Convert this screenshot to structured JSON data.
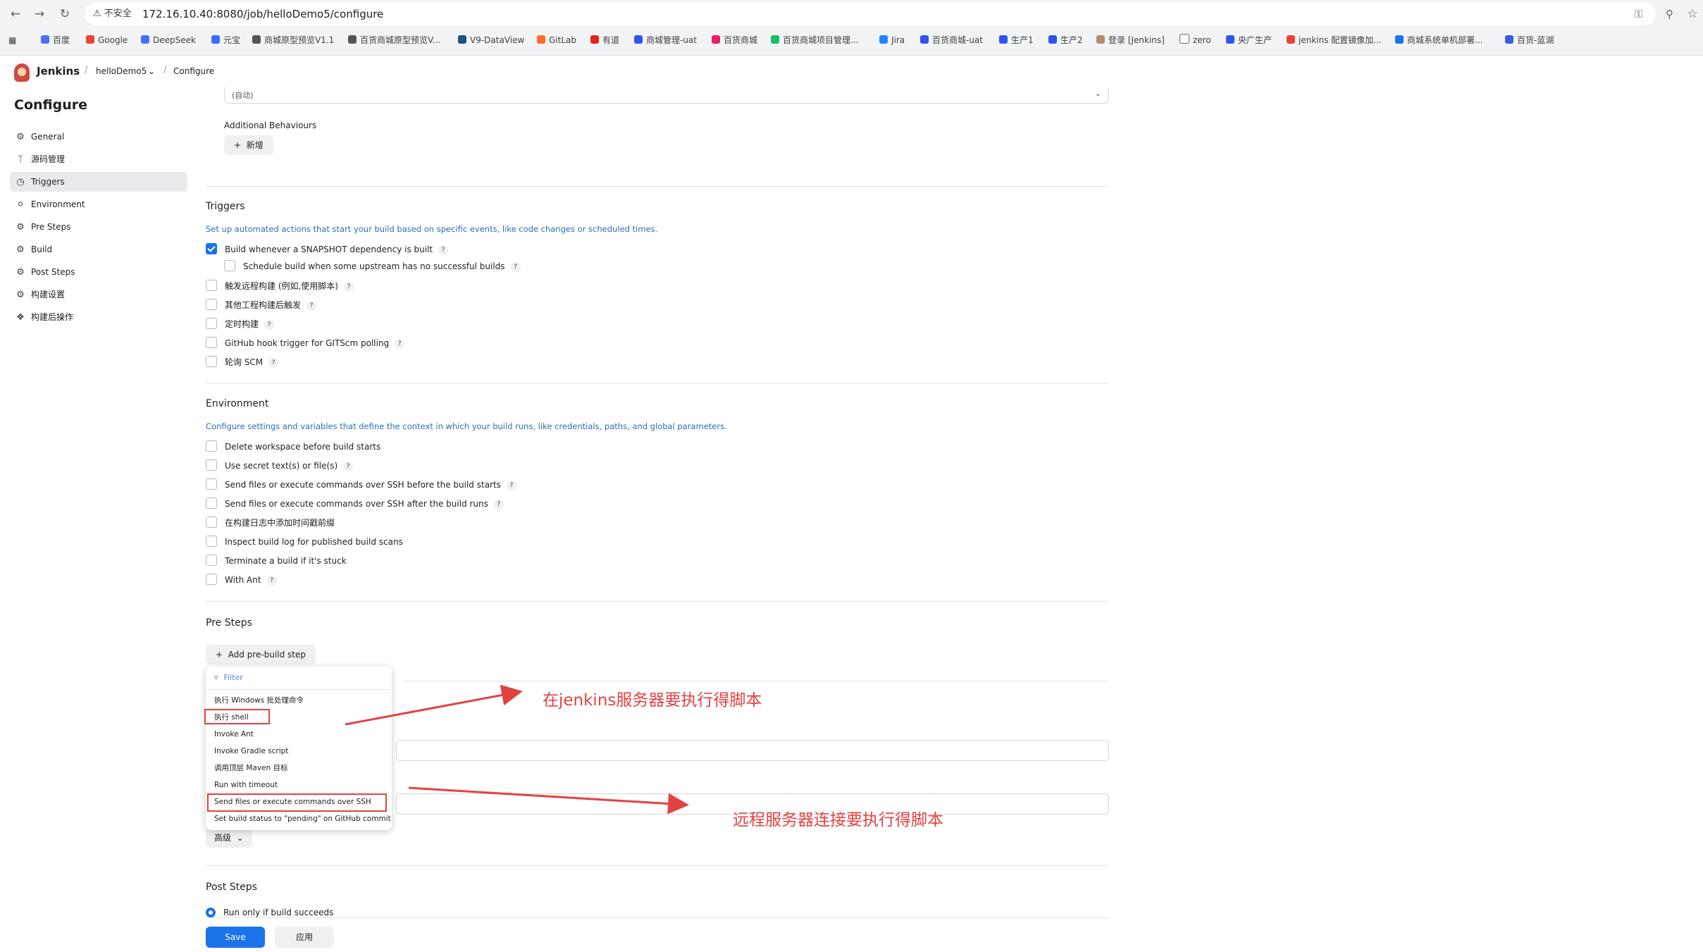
{
  "browser": {
    "security_label": "不安全",
    "url": "172.16.10.40:8080/job/helloDemo5/configure",
    "bookmarks": [
      "百度",
      "Google",
      "DeepSeek",
      "元宝",
      "商城原型预览V1.1",
      "百货商城原型预览V...",
      "V9-DataView",
      "GitLab",
      "有道",
      "商城管理-uat",
      "百货商城",
      "百货商城项目管理...",
      "Jira",
      "百货商城-uat",
      "生产1",
      "生产2",
      "登录 [Jenkins]",
      "zero",
      "央广生产",
      "jenkins 配置镜像加...",
      "商城系统单机部署...",
      "百货-蓝湖"
    ]
  },
  "header": {
    "app_name": "Jenkins",
    "breadcrumb_job": "helloDemo5",
    "breadcrumb_page": "Configure"
  },
  "sidebar": {
    "title": "Configure",
    "items": [
      {
        "label": "General",
        "icon": "gear-icon"
      },
      {
        "label": "源码管理",
        "icon": "branch-icon"
      },
      {
        "label": "Triggers",
        "icon": "clock-icon"
      },
      {
        "label": "Environment",
        "icon": "globe-icon"
      },
      {
        "label": "Pre Steps",
        "icon": "gear-icon"
      },
      {
        "label": "Build",
        "icon": "gear-icon"
      },
      {
        "label": "Post Steps",
        "icon": "gear-icon"
      },
      {
        "label": "构建设置",
        "icon": "gear-icon"
      },
      {
        "label": "构建后操作",
        "icon": "cube-icon"
      }
    ],
    "active_index": 2
  },
  "scm": {
    "select_value": "(自动)",
    "additional_behaviours": "Additional Behaviours",
    "add_label": "新增"
  },
  "triggers": {
    "title": "Triggers",
    "description": "Set up automated actions that start your build based on specific events, like code changes or scheduled times.",
    "options": [
      {
        "label": "Build whenever a SNAPSHOT dependency is built",
        "checked": true
      },
      {
        "label": "Schedule build when some upstream has no successful builds",
        "checked": false
      },
      {
        "label": "触发远程构建 (例如,使用脚本)",
        "checked": false
      },
      {
        "label": "其他工程构建后触发",
        "checked": false
      },
      {
        "label": "定时构建",
        "checked": false
      },
      {
        "label": "GitHub hook trigger for GITScm polling",
        "checked": false
      },
      {
        "label": "轮询 SCM",
        "checked": false
      }
    ]
  },
  "environment": {
    "title": "Environment",
    "description": "Configure settings and variables that define the context in which your build runs, like credentials, paths, and global parameters.",
    "options": [
      {
        "label": "Delete workspace before build starts",
        "checked": false
      },
      {
        "label": "Use secret text(s) or file(s)",
        "checked": false
      },
      {
        "label": "Send files or execute commands over SSH before the build starts",
        "checked": false
      },
      {
        "label": "Send files or execute commands over SSH after the build runs",
        "checked": false
      },
      {
        "label": "在构建日志中添加时间戳前缀",
        "checked": false
      },
      {
        "label": "Inspect build log for published build scans",
        "checked": false
      },
      {
        "label": "Terminate a build if it's stuck",
        "checked": false
      },
      {
        "label": "With Ant",
        "checked": false
      }
    ]
  },
  "pre_steps": {
    "title": "Pre Steps",
    "add_label": "Add pre-build step",
    "advanced_label": "高级"
  },
  "dropdown": {
    "filter_placeholder": "Filter",
    "items": [
      "执行 Windows 批处理命令",
      "执行 shell",
      "Invoke Ant",
      "Invoke Gradle script",
      "调用顶层 Maven 目标",
      "Run with timeout",
      "Send files or execute commands over SSH",
      "Set build status to \"pending\" on GitHub commit"
    ]
  },
  "annotations": {
    "shell_note": "在jenkins服务器要执行得脚本",
    "ssh_note": "远程服务器连接要执行得脚本",
    "color": "#e34242"
  },
  "post_steps": {
    "title": "Post Steps",
    "run_only_label": "Run only if build succeeds"
  },
  "footer": {
    "save_label": "Save",
    "apply_label": "应用"
  }
}
